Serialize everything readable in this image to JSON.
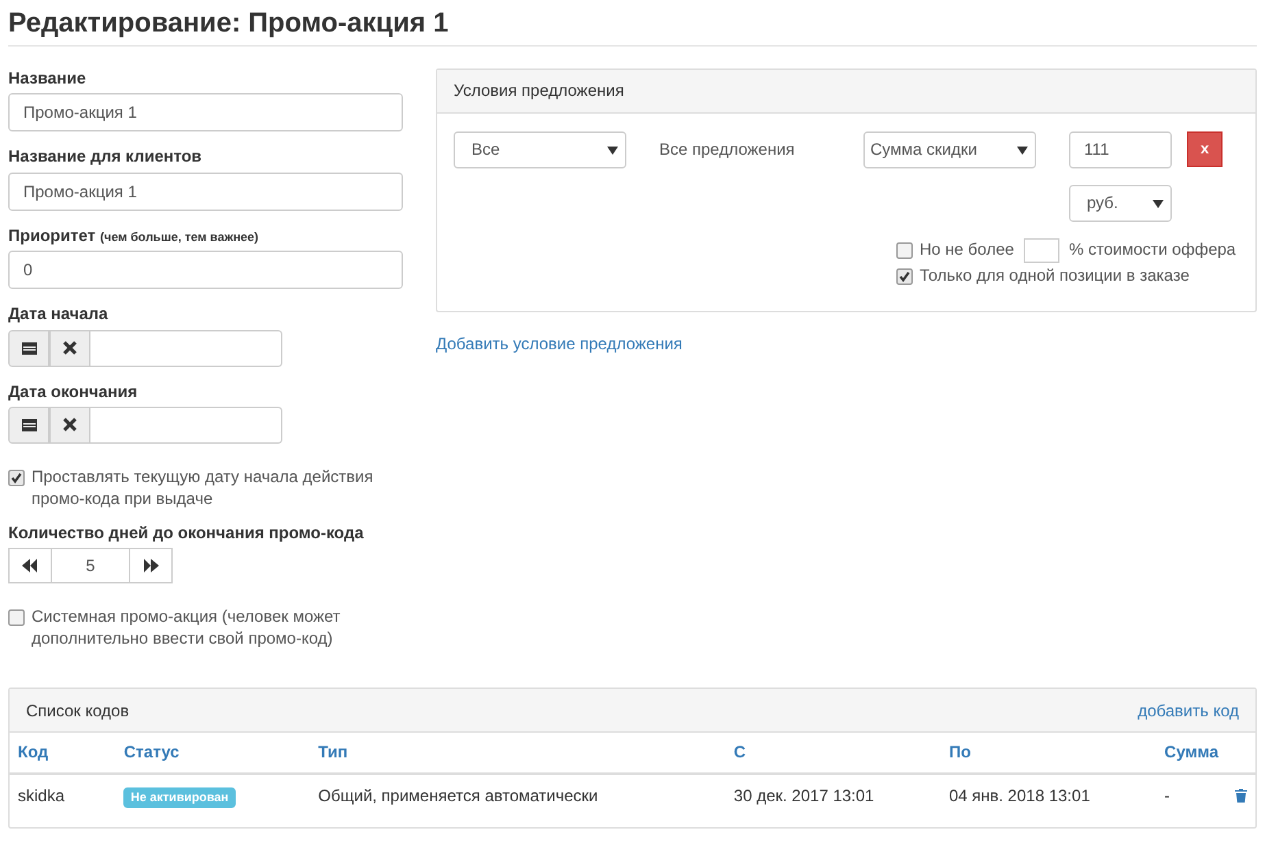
{
  "title": "Редактирование: Промо-акция 1",
  "form": {
    "name": {
      "label": "Название",
      "value": "Промо-акция 1"
    },
    "client_name": {
      "label": "Название для клиентов",
      "value": "Промо-акция 1"
    },
    "priority": {
      "label": "Приоритет",
      "hint": "(чем больше, тем важнее)",
      "value": "0"
    },
    "dates": [
      {
        "label": "Дата начала"
      },
      {
        "label": "Дата окончания"
      }
    ],
    "set_current_date": {
      "label": "Проставлять текущую дату начала действия промо-кода при выдаче",
      "checked": true
    },
    "days": {
      "label": "Количество дней до окончания промо-кода",
      "value": "5"
    },
    "system": {
      "label": "Системная промо-акция (человек может дополнительно ввести свой промо-код)",
      "checked": false
    }
  },
  "conditions": {
    "title": "Условия предложения",
    "scope": "Все",
    "scope_text": "Все предложения",
    "type": "Сумма скидки",
    "amount": "111",
    "currency": "руб.",
    "delete": "x",
    "cap": {
      "before": "Но не более",
      "after": "% стоимости оффера",
      "checked": false
    },
    "single": {
      "label": "Только для одной позиции в заказе",
      "checked": true
    },
    "add_link": "Добавить условие предложения"
  },
  "codes": {
    "title": "Список кодов",
    "add_link": "добавить код",
    "columns": [
      "Код",
      "Статус",
      "Тип",
      "С",
      "По",
      "Сумма"
    ],
    "rows": [
      {
        "code": "skidka",
        "status": "Не активирован",
        "type": "Общий, применяется автоматически",
        "from": "30 дек. 2017 13:01",
        "to": "04 янв. 2018 13:01",
        "sum": "-"
      }
    ]
  }
}
